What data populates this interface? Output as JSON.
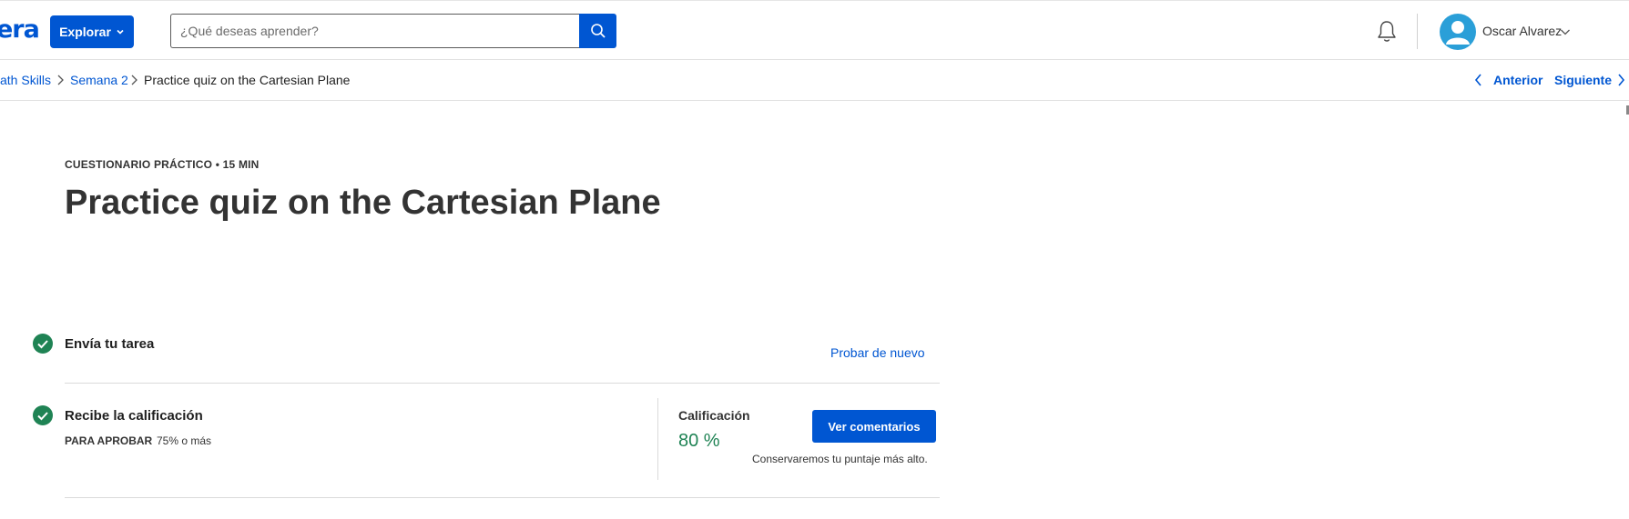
{
  "header": {
    "logo_text": "era",
    "explore_label": "Explorar",
    "search": {
      "placeholder": "¿Qué deseas aprender?",
      "value": ""
    },
    "user_name": "Oscar Alvarez"
  },
  "breadcrumb": {
    "items": [
      "ath Skills",
      "Semana 2",
      "Practice quiz on the Cartesian Plane"
    ]
  },
  "pager": {
    "prev_label": "Anterior",
    "next_label": "Siguiente"
  },
  "quiz": {
    "eyebrow": "CUESTIONARIO PRÁCTICO • 15 MIN",
    "title": "Practice quiz on the Cartesian Plane",
    "submit_step": {
      "title": "Envía tu tarea",
      "retry_label": "Probar de nuevo"
    },
    "grade_step": {
      "title": "Recibe la calificación",
      "pass_label": "PARA APROBAR",
      "pass_value": "75% o más",
      "grade_label": "Calificación",
      "grade_value": "80 %",
      "feedback_label": "Ver comentarios",
      "keep_note": "Conservaremos tu puntaje más alto."
    }
  },
  "colors": {
    "brand": "#0056d2",
    "success": "#1f8354",
    "avatar": "#2a9fd8"
  }
}
